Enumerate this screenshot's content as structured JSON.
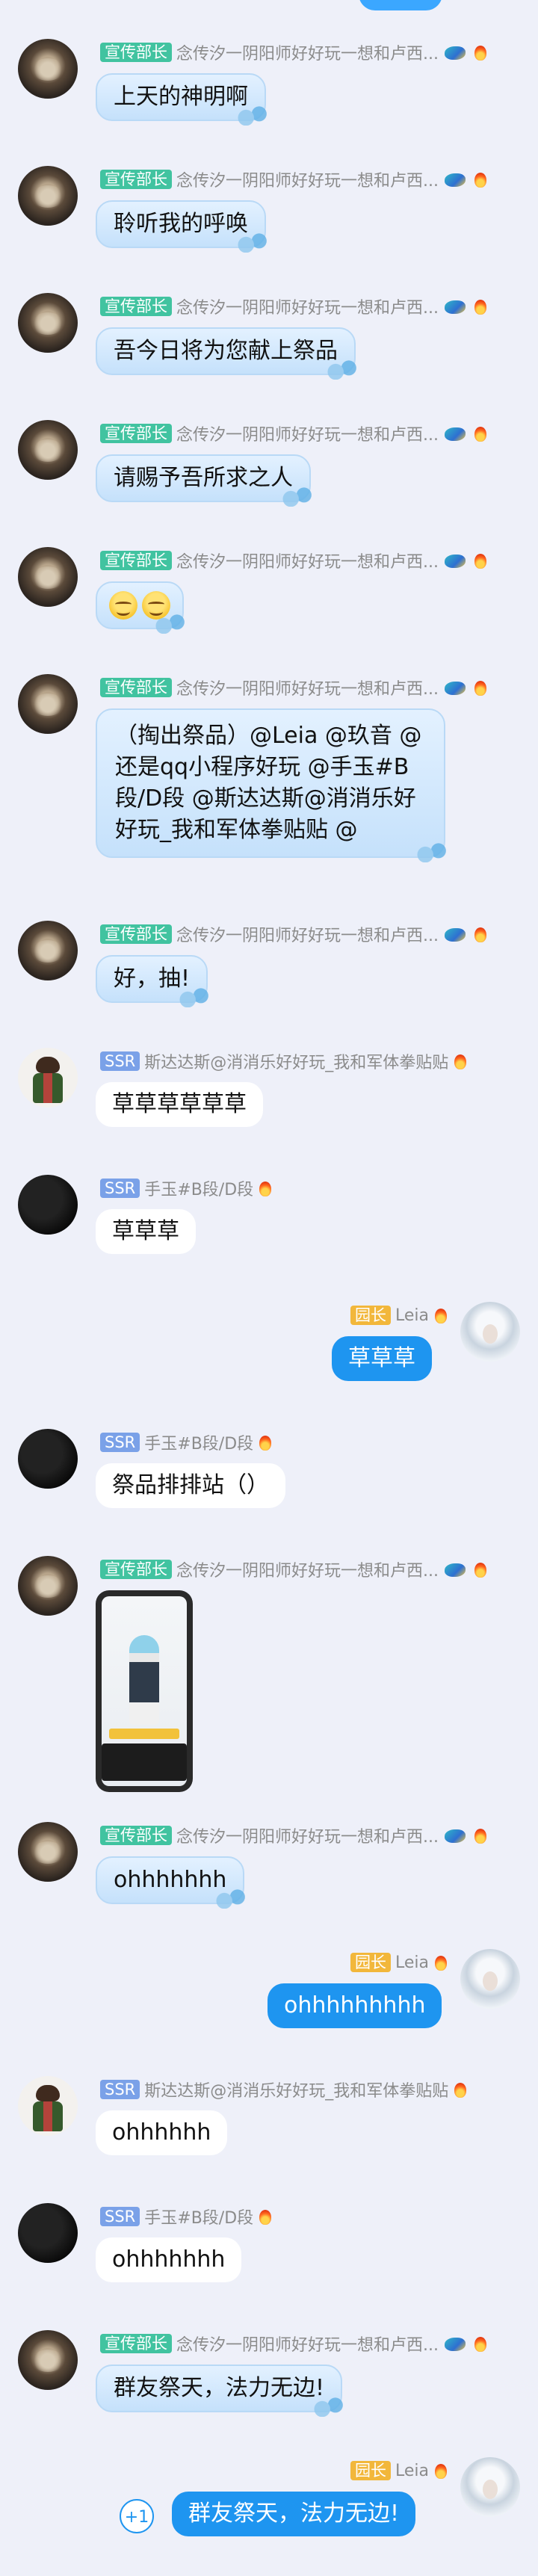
{
  "users": {
    "nian": {
      "badge": "宣传部长",
      "name": "念传汐一阴阳师好好玩一想和卢西..."
    },
    "sida": {
      "badge": "SSR",
      "name": "斯达达斯@消消乐好好玩_我和军体拳贴贴"
    },
    "shouyu": {
      "badge": "SSR",
      "name": "手玉#B段/D段"
    },
    "leia": {
      "badge": "园长",
      "name": "Leia"
    }
  },
  "messages": [
    {
      "text": "上天的神明啊"
    },
    {
      "text": "聆听我的呼唤"
    },
    {
      "text": "吾今日将为您献上祭品"
    },
    {
      "text": "请赐予吾所求之人"
    },
    {
      "text": ""
    },
    {
      "text": "（掏出祭品）@Leia @玖音 @还是qq小程序好玩 @手玉#B段/D段 @斯达达斯@消消乐好好玩_我和军体拳贴贴 @"
    },
    {
      "text": "好，抽!"
    },
    {
      "text": "草草草草草草"
    },
    {
      "text": "草草草"
    },
    {
      "text": "草草草"
    },
    {
      "text": "祭品排排站（）"
    },
    {
      "text": ""
    },
    {
      "text": "ohhhhhhh"
    },
    {
      "text": "ohhhhhhhhh"
    },
    {
      "text": "ohhhhhh"
    },
    {
      "text": "ohhhhhhh"
    },
    {
      "text": "群友祭天，法力无边!"
    },
    {
      "text": "群友祭天，法力无边!"
    }
  ],
  "plus_one": "+1",
  "icons": {
    "fire": "fire-icon",
    "dragon": "dragon-badge-icon"
  },
  "colors": {
    "background": "#eef0f9",
    "self_bubble": "#1e95f0",
    "badge_green": "#41c3a0",
    "badge_ssr": "#7aa1e8",
    "badge_gold": "#f2b73b"
  }
}
